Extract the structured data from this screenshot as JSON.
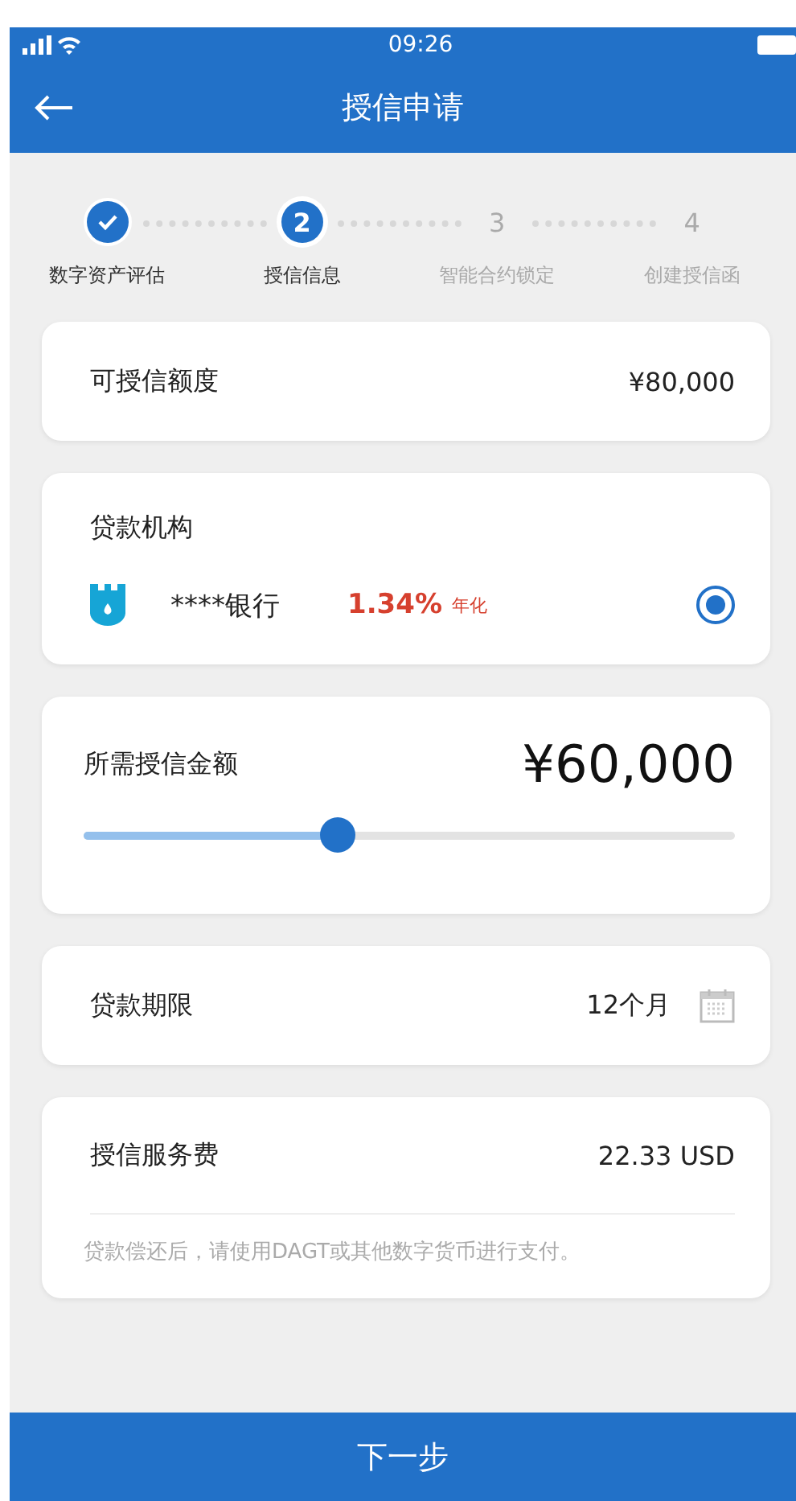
{
  "status_bar": {
    "time": "09:26"
  },
  "nav": {
    "title": "授信申请"
  },
  "steps": [
    {
      "label": "数字资产评估",
      "done": true,
      "selected": false
    },
    {
      "marker": "2",
      "label": "授信信息",
      "done": false,
      "selected": true
    },
    {
      "marker": "3",
      "label": "智能合约锁定",
      "done": false,
      "selected": false
    },
    {
      "marker": "4",
      "label": "创建授信函",
      "done": false,
      "selected": false
    }
  ],
  "credit_limit": {
    "label": "可授信额度",
    "value": "¥80,000"
  },
  "lender": {
    "label": "贷款机构",
    "name": "****银行",
    "rate": "1.34%",
    "rate_unit": "年化",
    "selected": true
  },
  "amount": {
    "label": "所需授信金额",
    "value": "¥60,000",
    "level": 0.39
  },
  "term": {
    "label": "贷款期限",
    "value": "12个月"
  },
  "fee": {
    "label": "授信服务费",
    "value": "22.33 USD",
    "note": "贷款偿还后，请使用DAGT或其他数字货币进行支付。"
  },
  "next_button": "下一步"
}
